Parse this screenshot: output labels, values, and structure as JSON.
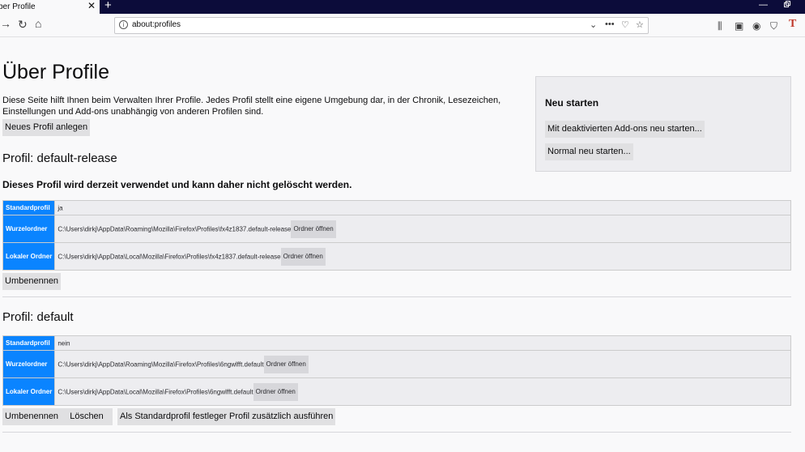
{
  "browser": {
    "tab_title": "ber Profile",
    "url": "about:profiles"
  },
  "page": {
    "title": "Über Profile",
    "intro": "Diese Seite hilft Ihnen beim Verwalten Ihrer Profile. Jedes Profil stellt eine eigene Umgebung dar, in der Chronik, Lesezeichen, Einstellungen und Add-ons unabhängig von anderen Profilen sind.",
    "new_profile_button": "Neues Profil anlegen"
  },
  "restart": {
    "title": "Neu starten",
    "safe_mode_button": "Mit deaktivierten Add-ons neu starten...",
    "normal_button": "Normal neu starten..."
  },
  "profiles": [
    {
      "title": "Profil: default-release",
      "warning": "Dieses Profil wird derzeit verwendet und kann daher nicht gelöscht werden.",
      "rows": [
        {
          "label": "Standardprofil",
          "value": "ja"
        },
        {
          "label": "Wurzelordner",
          "value": "C:\\Users\\dirkj\\AppData\\Roaming\\Mozilla\\Firefox\\Profiles\\fx4z1837.default-release",
          "button": "Ordner öffnen"
        },
        {
          "label": "Lokaler Ordner",
          "value": "C:\\Users\\dirkj\\AppData\\Local\\Mozilla\\Firefox\\Profiles\\fx4z1837.default-release",
          "button": "Ordner öffnen"
        }
      ],
      "actions": {
        "rename": "Umbenennen"
      }
    },
    {
      "title": "Profil: default",
      "rows": [
        {
          "label": "Standardprofil",
          "value": "nein"
        },
        {
          "label": "Wurzelordner",
          "value": "C:\\Users\\dirkj\\AppData\\Roaming\\Mozilla\\Firefox\\Profiles\\6ngwlfft.default",
          "button": "Ordner öffnen"
        },
        {
          "label": "Lokaler Ordner",
          "value": "C:\\Users\\dirkj\\AppData\\Local\\Mozilla\\Firefox\\Profiles\\6ngwlfft.default",
          "button": "Ordner öffnen"
        }
      ],
      "actions": {
        "rename": "Umbenennen",
        "delete": "Löschen",
        "set_default": "Als Standardprofil festlegen",
        "launch": "Profil zusätzlich ausführen"
      }
    }
  ]
}
